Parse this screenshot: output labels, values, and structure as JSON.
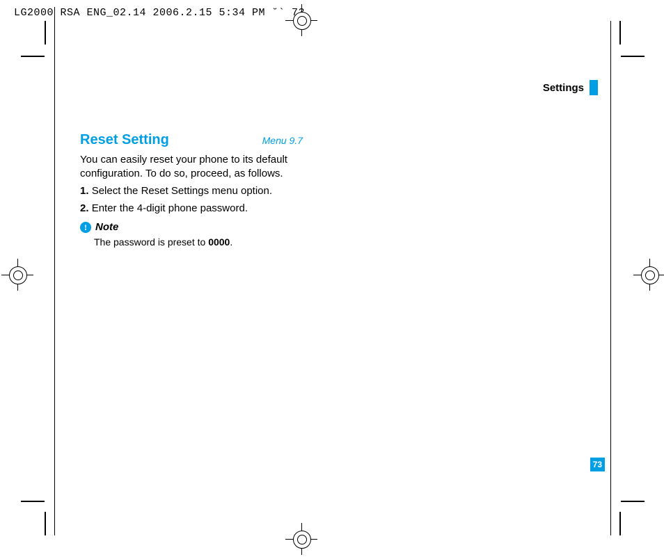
{
  "header_line": "LG2000 RSA ENG_02.14  2006.2.15 5:34 PM  ˘` 73",
  "chapter": "Settings",
  "section_title": "Reset Setting",
  "menu_ref": "Menu 9.7",
  "intro": "You can easily reset your phone to its default configuration. To do so, proceed, as follows.",
  "steps": [
    {
      "num": "1.",
      "text": "Select the Reset Settings menu option."
    },
    {
      "num": "2.",
      "text": "Enter the 4-digit phone password."
    }
  ],
  "note_label": "Note",
  "note_prefix": "The password is preset to ",
  "note_bold": "0000",
  "note_suffix": ".",
  "page_number": "73"
}
